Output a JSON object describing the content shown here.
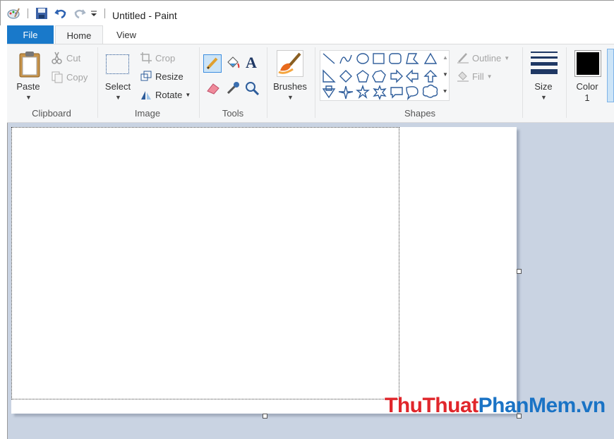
{
  "window": {
    "title": "Untitled - Paint"
  },
  "tabs": {
    "file": "File",
    "home": "Home",
    "view": "View"
  },
  "clipboard": {
    "paste": "Paste",
    "cut": "Cut",
    "copy": "Copy",
    "label": "Clipboard"
  },
  "image": {
    "select": "Select",
    "crop": "Crop",
    "resize": "Resize",
    "rotate": "Rotate",
    "label": "Image"
  },
  "tools": {
    "label": "Tools"
  },
  "brushes": {
    "label": "Brushes"
  },
  "shapes": {
    "outline": "Outline",
    "fill": "Fill",
    "label": "Shapes"
  },
  "size": {
    "label": "Size"
  },
  "color1": {
    "label": "Color",
    "number": "1",
    "value": "#000000"
  },
  "watermark": {
    "part1": "ThuThuat",
    "part2": "PhanMem",
    "part3": ".vn"
  },
  "colors": {
    "file_tab": "#1979ca",
    "workspace": "#c9d3e2",
    "watermark_red": "#e0262b",
    "watermark_blue": "#1a73c5"
  }
}
